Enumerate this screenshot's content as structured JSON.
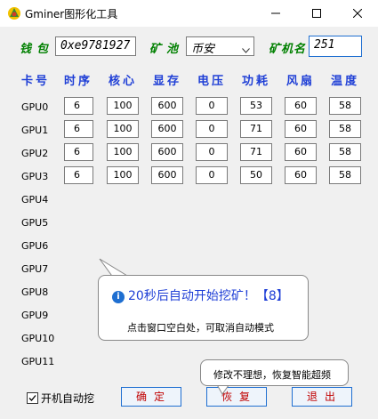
{
  "window": {
    "title": "Gminer图形化工具",
    "controls": {
      "minimize_icon": "minimize-icon",
      "maximize_icon": "maximize-icon",
      "close_icon": "close-icon"
    }
  },
  "wallet": {
    "label": "钱包",
    "value": "0xe9781927"
  },
  "pool": {
    "label": "矿池",
    "selected": "币安"
  },
  "miner_name": {
    "label": "矿机名",
    "value": "251"
  },
  "columns": [
    "卡号",
    "时序",
    "核心",
    "显存",
    "电压",
    "功耗",
    "风扇",
    "温度"
  ],
  "gpus": [
    {
      "label": "GPU0",
      "values": [
        "6",
        "100",
        "600",
        "0",
        "53",
        "60",
        "58"
      ]
    },
    {
      "label": "GPU1",
      "values": [
        "6",
        "100",
        "600",
        "0",
        "71",
        "60",
        "58"
      ]
    },
    {
      "label": "GPU2",
      "values": [
        "6",
        "100",
        "600",
        "0",
        "71",
        "60",
        "58"
      ]
    },
    {
      "label": "GPU3",
      "values": [
        "6",
        "100",
        "600",
        "0",
        "50",
        "60",
        "58"
      ]
    },
    {
      "label": "GPU4"
    },
    {
      "label": "GPU5"
    },
    {
      "label": "GPU6"
    },
    {
      "label": "GPU7"
    },
    {
      "label": "GPU8"
    },
    {
      "label": "GPU9"
    },
    {
      "label": "GPU10"
    },
    {
      "label": "GPU11"
    }
  ],
  "auto_tip": {
    "title": "20秒后自动开始挖矿！【8】",
    "body": "点击窗口空白处，可取消自动模式"
  },
  "autostart": {
    "label": "开机自动挖",
    "checked": true
  },
  "buttons": {
    "ok": "确定",
    "restore": "恢复",
    "exit": "退出"
  },
  "restore_tip": "修改不理想，恢复智能超频",
  "colors": {
    "label_green": "#008000",
    "header_blue": "#1f3fd6",
    "button_text_red": "#c00000",
    "button_border_blue": "#1f6fd1"
  }
}
